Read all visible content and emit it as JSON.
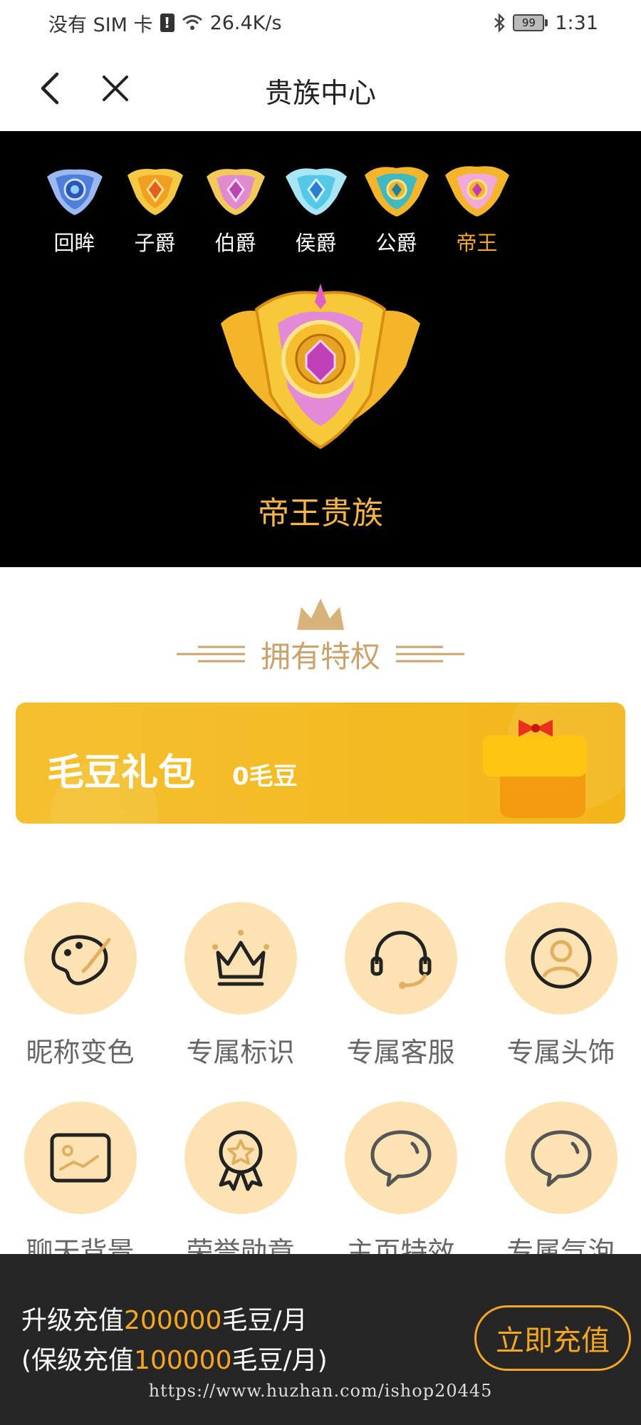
{
  "status_bar": {
    "carrier": "没有 SIM 卡",
    "sim_alert": "!",
    "speed": "26.4K/s",
    "battery": "99",
    "time": "1:31"
  },
  "nav": {
    "title": "贵族中心"
  },
  "levels": [
    {
      "label": "回眸",
      "icon": "blue-badge-icon",
      "color": "#4f7fd8",
      "active": false
    },
    {
      "label": "子爵",
      "icon": "orange-badge-icon",
      "color": "#f0a020",
      "active": false
    },
    {
      "label": "伯爵",
      "icon": "pink-badge-icon",
      "color": "#e08ad0",
      "active": false
    },
    {
      "label": "侯爵",
      "icon": "cyan-badge-icon",
      "color": "#55c8e8",
      "active": false
    },
    {
      "label": "公爵",
      "icon": "gold-teal-badge-icon",
      "color": "#f4b52a",
      "active": false
    },
    {
      "label": "帝王",
      "icon": "gold-pink-badge-icon",
      "color": "#f2a8d8",
      "active": true
    }
  ],
  "hero": {
    "badge_icon": "emperor-badge-icon",
    "title": "帝王贵族"
  },
  "privileges": {
    "title": "拥有特权"
  },
  "gift": {
    "name": "毛豆礼包",
    "amount": "0毛豆",
    "icon": "gift-box-icon"
  },
  "perks": [
    {
      "label": "昵称变色",
      "icon": "palette-icon"
    },
    {
      "label": "专属标识",
      "icon": "crown-icon"
    },
    {
      "label": "专属客服",
      "icon": "headset-icon"
    },
    {
      "label": "专属头饰",
      "icon": "avatar-icon"
    },
    {
      "label": "聊天背景",
      "icon": "image-icon"
    },
    {
      "label": "荣誉勋章",
      "icon": "medal-icon"
    },
    {
      "label": "主页特效",
      "icon": "chat-bubble-icon"
    },
    {
      "label": "专属气泡",
      "icon": "chat-bubble-icon"
    }
  ],
  "upgrade": {
    "line1_prefix": "升级充值",
    "line1_amount": "200000",
    "line1_suffix": "毛豆/月",
    "line2_prefix": "(保级充值",
    "line2_amount": "100000",
    "line2_suffix": "毛豆/月)",
    "button": "立即充值"
  },
  "watermark": "https://www.huzhan.com/ishop20445",
  "colors": {
    "accent": "#f5a623",
    "gift_bg": "#f2b61a",
    "perk_circle": "#fde3b3",
    "bottom_bar": "#262626"
  }
}
